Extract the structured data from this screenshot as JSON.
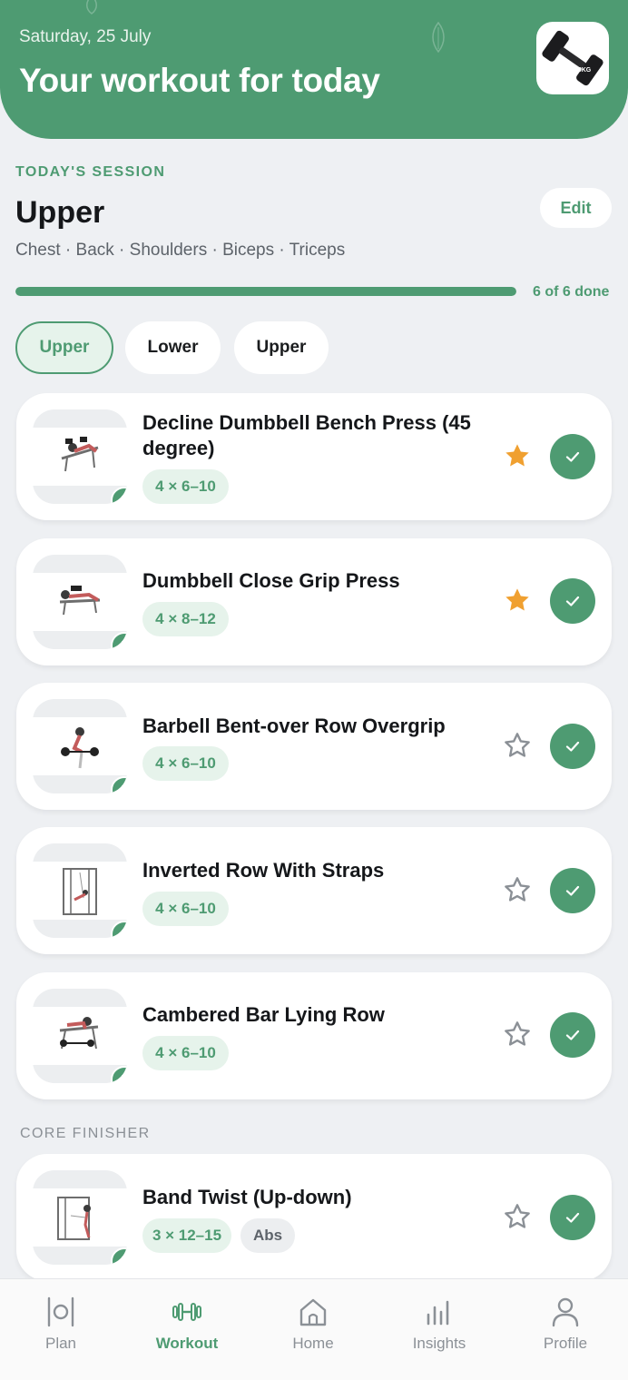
{
  "header": {
    "date": "Saturday, 25 July",
    "title": "Your workout for today",
    "badge_icon": "dumbbell-icon",
    "badge_text": "5KG"
  },
  "session": {
    "label": "TODAY'S SESSION",
    "title": "Upper",
    "muscles": "Chest · Back · Shoulders · Biceps · Triceps",
    "edit_label": "Edit",
    "progress_text": "6 of 6 done",
    "progress_done": 6,
    "progress_total": 6
  },
  "chips": [
    {
      "label": "Upper",
      "active": true
    },
    {
      "label": "Lower",
      "active": false
    },
    {
      "label": "Upper",
      "active": false
    }
  ],
  "exercises": [
    {
      "name": "Decline Dumbbell Bench Press (45 degree)",
      "sets": "4 × 6–10",
      "starred": true,
      "done": true
    },
    {
      "name": "Dumbbell Close Grip Press",
      "sets": "4 × 8–12",
      "starred": true,
      "done": true
    },
    {
      "name": "Barbell Bent-over Row Overgrip",
      "sets": "4 × 6–10",
      "starred": false,
      "done": true
    },
    {
      "name": "Inverted Row With Straps",
      "sets": "4 × 6–10",
      "starred": false,
      "done": true
    },
    {
      "name": "Cambered Bar Lying Row",
      "sets": "4 × 6–10",
      "starred": false,
      "done": true
    }
  ],
  "finisher": {
    "label": "CORE FINISHER",
    "exercise": {
      "name": "Band Twist (Up-down)",
      "sets": "3 × 12–15",
      "muscle": "Abs",
      "starred": false,
      "done": true
    }
  },
  "nav": [
    {
      "label": "Plan",
      "icon": "fork-plate-icon",
      "active": false
    },
    {
      "label": "Workout",
      "icon": "dumbbell-icon",
      "active": true
    },
    {
      "label": "Home",
      "icon": "home-icon",
      "active": false
    },
    {
      "label": "Insights",
      "icon": "bar-chart-icon",
      "active": false
    },
    {
      "label": "Profile",
      "icon": "person-icon",
      "active": false
    }
  ],
  "colors": {
    "accent": "#4e9b72",
    "accent_light": "#e6f3eb",
    "star_gold": "#f0a030",
    "background": "#eef0f3"
  }
}
